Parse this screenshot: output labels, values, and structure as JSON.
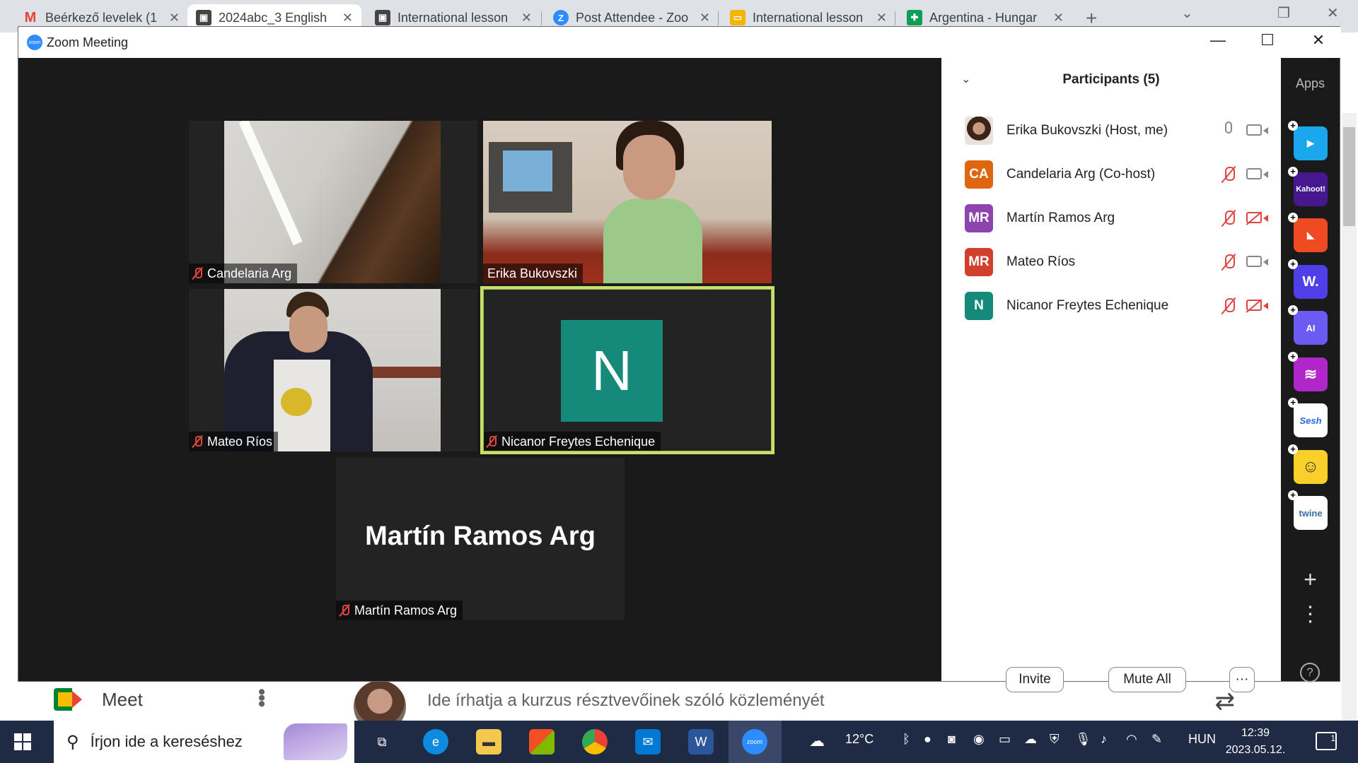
{
  "browser": {
    "tabs": [
      {
        "title": "Beérkező levelek (1",
        "icon": "gmail-icon",
        "color": "#ea4335",
        "glyph": "M"
      },
      {
        "title": "2024abc_3 English",
        "icon": "classroom-icon",
        "color": "#444444",
        "glyph": "▣"
      },
      {
        "title": "International lesson",
        "icon": "classroom-icon",
        "color": "#444444",
        "glyph": "▣"
      },
      {
        "title": "Post Attendee - Zoo",
        "icon": "zoom-icon",
        "color": "#2d8cff",
        "glyph": "Z"
      },
      {
        "title": "International lesson",
        "icon": "slides-icon",
        "color": "#f4b400",
        "glyph": "▭"
      },
      {
        "title": "Argentina - Hungar",
        "icon": "sheets-icon",
        "color": "#0f9d58",
        "glyph": "✚"
      }
    ],
    "new_tab": "+"
  },
  "background": {
    "meet_label": "Meet",
    "post_placeholder": "Ide írhatja a kurzus résztvevőinek szóló közleményét"
  },
  "zoom": {
    "window_title": "Zoom Meeting",
    "logo_text": "zoom",
    "tiles": {
      "candelaria": "Candelaria Arg",
      "erika": "Erika Bukovszki",
      "mateo": "Mateo Ríos",
      "nicanor": "Nicanor Freytes Echenique",
      "nicanor_initial": "N",
      "martin_big": "Martín Ramos Arg",
      "martin": "Martín Ramos Arg"
    },
    "active_speaker_color": "#c8e06a"
  },
  "participants": {
    "title": "Participants (5)",
    "list": [
      {
        "name": "Erika Bukovszki (Host, me)",
        "initials": "",
        "color": "",
        "mic": "on",
        "cam": "on"
      },
      {
        "name": "Candelaria Arg (Co-host)",
        "initials": "CA",
        "color": "#e0650f",
        "mic": "muted",
        "cam": "on"
      },
      {
        "name": "Martín Ramos Arg",
        "initials": "MR",
        "color": "#8e44ad",
        "mic": "muted",
        "cam": "off"
      },
      {
        "name": "Mateo Ríos",
        "initials": "MR",
        "color": "#d0402c",
        "mic": "muted",
        "cam": "on"
      },
      {
        "name": "Nicanor Freytes Echenique",
        "initials": "N",
        "color": "#168a7a",
        "mic": "muted",
        "cam": "off"
      }
    ],
    "invite_label": "Invite",
    "mute_all_label": "Mute All",
    "more_label": "···"
  },
  "apps": {
    "title": "Apps",
    "items": [
      {
        "name": "flip-app",
        "label": "▶",
        "color": "#1aa7ec"
      },
      {
        "name": "kahoot-app",
        "label": "Kahoot!",
        "color": "#46178f"
      },
      {
        "name": "red-app",
        "label": "◣",
        "color": "#f04a23"
      },
      {
        "name": "wooclap-app",
        "label": "W.",
        "color": "#4f3fe8"
      },
      {
        "name": "ai-app",
        "label": "AI",
        "color": "#6a5cf2"
      },
      {
        "name": "stripes-app",
        "label": "≋",
        "color": "#b026c8"
      },
      {
        "name": "sesh-app",
        "label": "Sesh",
        "color": "#ffffff"
      },
      {
        "name": "emoji-app",
        "label": "☺",
        "color": "#f9cf2a"
      },
      {
        "name": "twine-app",
        "label": "twine",
        "color": "#ffffff"
      }
    ],
    "add": "+",
    "more": "⋮",
    "help": "?"
  },
  "taskbar": {
    "search_placeholder": "Írjon ide a kereséshez",
    "weather": "12°C",
    "language": "HUN",
    "time": "12:39",
    "date": "2023.05.12.",
    "notifications": "1"
  }
}
